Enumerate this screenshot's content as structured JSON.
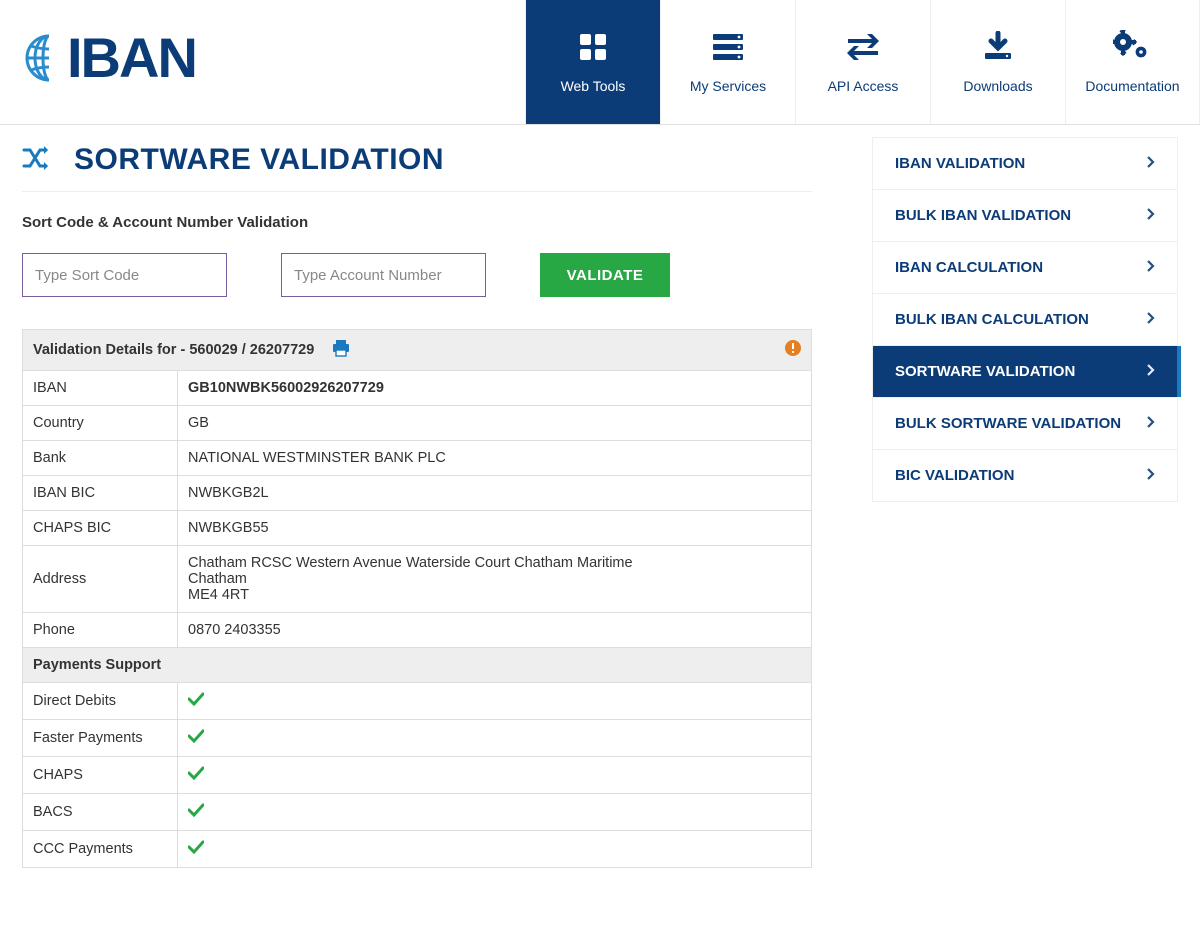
{
  "brand_text": "IBAN",
  "topnav": [
    {
      "label": "Web Tools",
      "active": true
    },
    {
      "label": "My Services",
      "active": false
    },
    {
      "label": "API Access",
      "active": false
    },
    {
      "label": "Downloads",
      "active": false
    },
    {
      "label": "Documentation",
      "active": false
    }
  ],
  "page_title": "SORTWARE VALIDATION",
  "form_label": "Sort Code & Account Number Validation",
  "inputs": {
    "sort_code_placeholder": "Type Sort Code",
    "account_placeholder": "Type Account Number",
    "validate_button": "VALIDATE"
  },
  "results": {
    "heading_prefix": "Validation Details for - ",
    "sort_code": "560029",
    "account": "26207729",
    "rows": [
      {
        "label": "IBAN",
        "value": "GB10NWBK56002926207729",
        "bold": true
      },
      {
        "label": "Country",
        "value": "GB"
      },
      {
        "label": "Bank",
        "value": "NATIONAL WESTMINSTER BANK PLC"
      },
      {
        "label": "IBAN BIC",
        "value": "NWBKGB2L"
      },
      {
        "label": "CHAPS BIC",
        "value": "NWBKGB55"
      },
      {
        "label": "Address",
        "value": "Chatham RCSC Western Avenue Waterside Court Chatham Maritime\nChatham\nME4 4RT"
      },
      {
        "label": "Phone",
        "value": "0870 2403355"
      }
    ],
    "payments_heading": "Payments Support",
    "payments": [
      {
        "label": "Direct Debits",
        "supported": true
      },
      {
        "label": "Faster Payments",
        "supported": true
      },
      {
        "label": "CHAPS",
        "supported": true
      },
      {
        "label": "BACS",
        "supported": true
      },
      {
        "label": "CCC Payments",
        "supported": true
      }
    ]
  },
  "sidenav": [
    {
      "label": "IBAN VALIDATION",
      "active": false
    },
    {
      "label": "BULK IBAN VALIDATION",
      "active": false
    },
    {
      "label": "IBAN CALCULATION",
      "active": false
    },
    {
      "label": "BULK IBAN CALCULATION",
      "active": false
    },
    {
      "label": "SORTWARE VALIDATION",
      "active": true
    },
    {
      "label": "BULK SORTWARE VALIDATION",
      "active": false
    },
    {
      "label": "BIC VALIDATION",
      "active": false
    }
  ]
}
